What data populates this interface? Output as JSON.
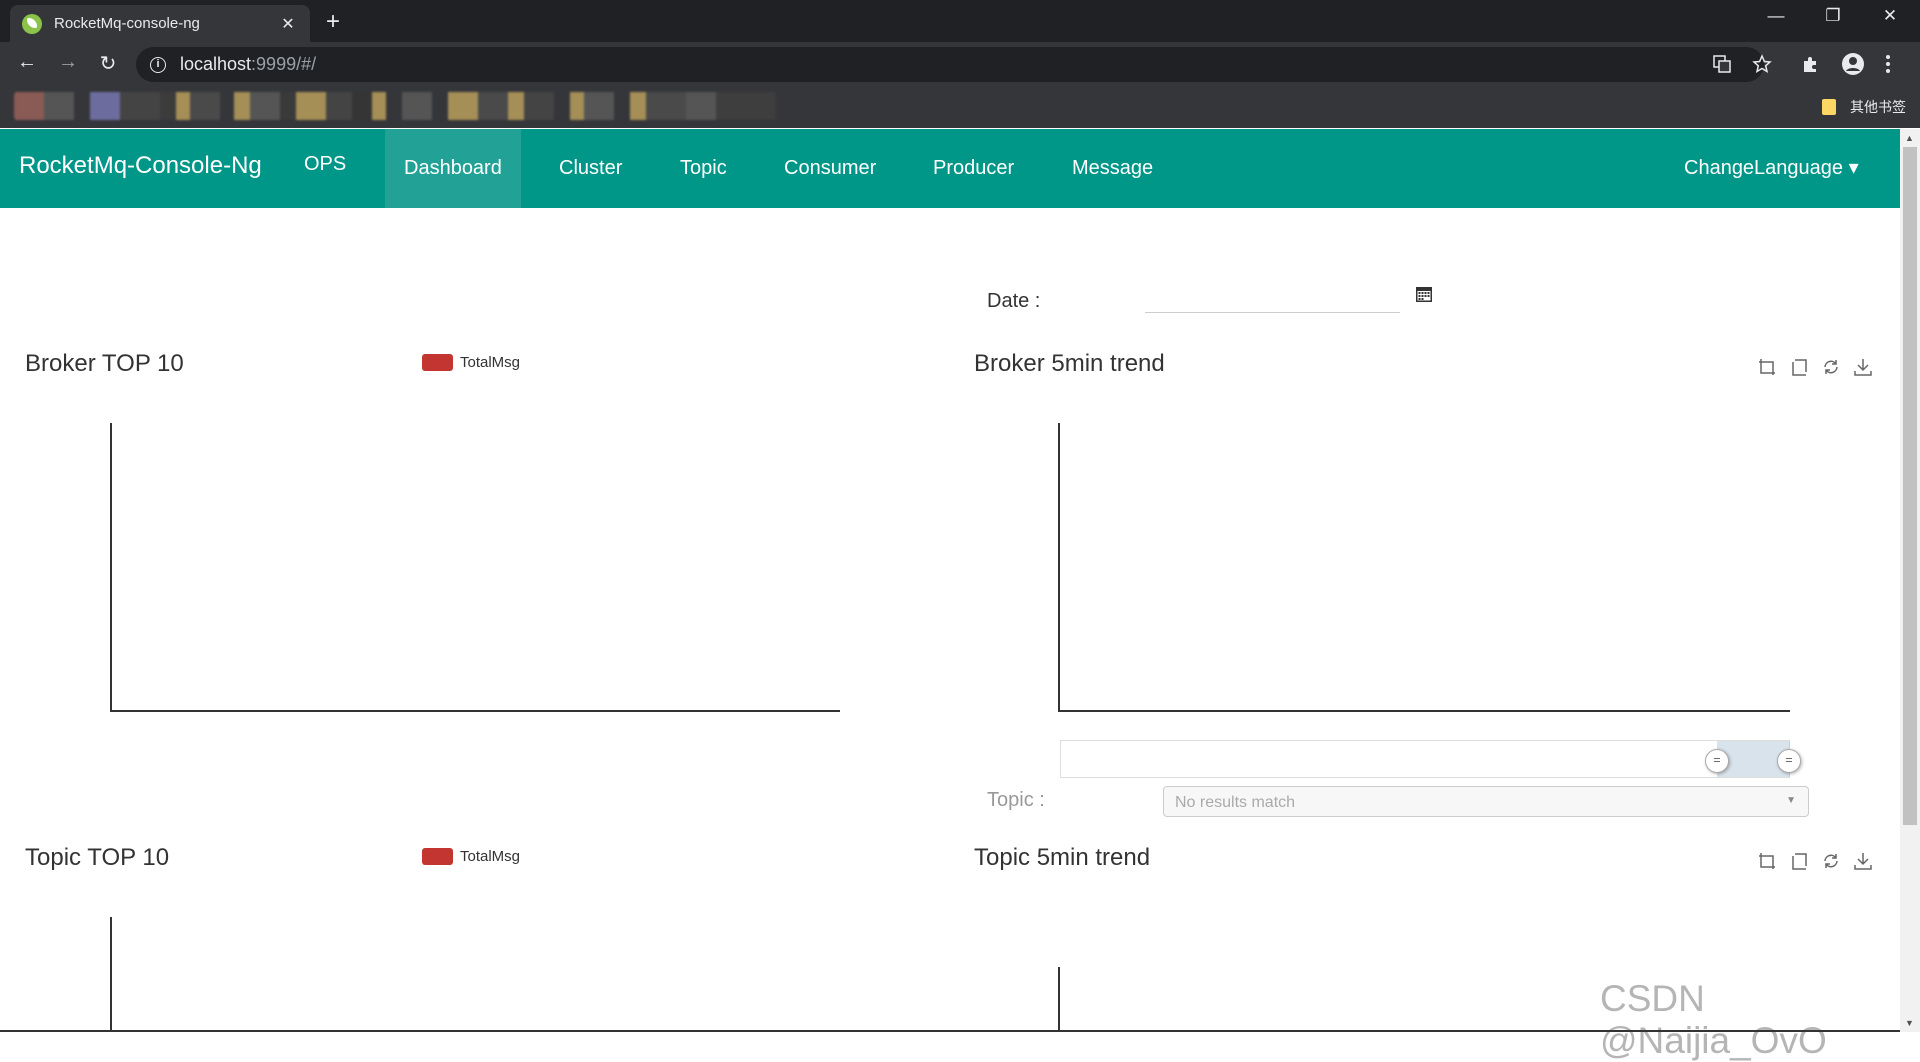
{
  "browser": {
    "tab_title": "RocketMq-console-ng",
    "close_glyph": "✕",
    "newtab_glyph": "+",
    "url_host": "localhost",
    "url_rest": ":9999/#/",
    "other_bookmarks": "其他书签",
    "window_controls": {
      "minimize": "—",
      "restore": "❐",
      "close": "✕"
    },
    "nav": {
      "back": "←",
      "forward": "→",
      "reload": "↻"
    }
  },
  "app": {
    "brand": "RocketMq-Console-Ng",
    "nav": {
      "ops": "OPS",
      "dashboard": "Dashboard",
      "cluster": "Cluster",
      "topic": "Topic",
      "consumer": "Consumer",
      "producer": "Producer",
      "message": "Message"
    },
    "change_language": "ChangeLanguage ▾",
    "accent_color": "#009688"
  },
  "dashboard": {
    "date_label": "Date :",
    "date_value": "",
    "broker_top": {
      "title": "Broker TOP 10",
      "legend": "TotalMsg",
      "legend_color": "#c23531"
    },
    "broker_trend": {
      "title": "Broker 5min trend"
    },
    "topic_label": "Topic :",
    "topic_select_placeholder": "No results match",
    "topic_top": {
      "title": "Topic TOP 10",
      "legend": "TotalMsg",
      "legend_color": "#c23531"
    },
    "topic_trend": {
      "title": "Topic 5min trend"
    }
  },
  "watermark": "CSDN @Naijia_OvO"
}
